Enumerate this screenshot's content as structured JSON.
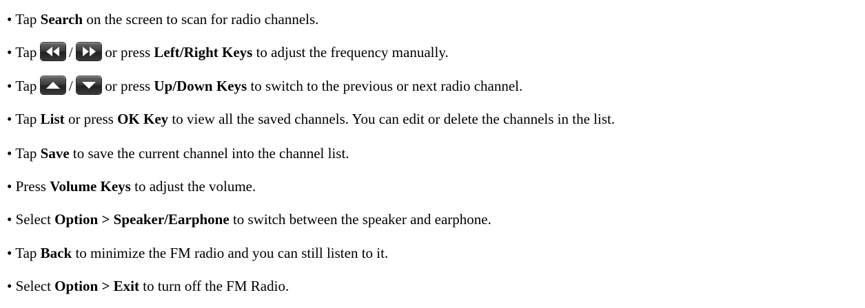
{
  "bullet": "•",
  "lines": [
    {
      "pre": "Tap ",
      "b1": "Search",
      "post": " on the screen to scan for radio channels."
    },
    {
      "pre": "Tap ",
      "sep": " / ",
      "mid": " or press ",
      "b1": "Left/Right Keys",
      "post": " to adjust the frequency manually."
    },
    {
      "pre": "Tap ",
      "sep": " / ",
      "mid": " or press ",
      "b1": "Up/Down Keys",
      "post": " to switch to the previous or next radio channel."
    },
    {
      "pre": "Tap ",
      "b1": "List",
      "mid": " or press ",
      "b2": "OK Key",
      "post": " to view all the saved channels. You can edit or delete the channels in the list."
    },
    {
      "pre": "Tap ",
      "b1": "Save",
      "post": " to save the current channel into the channel list."
    },
    {
      "pre": "Press ",
      "b1": "Volume Keys",
      "post": " to adjust the volume."
    },
    {
      "pre": "Select ",
      "b1": "Option > Speaker/Earphone",
      "post": " to switch between the speaker and earphone."
    },
    {
      "pre": "Tap ",
      "b1": "Back",
      "post": " to minimize the FM radio and you can still listen to it."
    },
    {
      "pre": "Select ",
      "b1": "Option > Exit",
      "post": " to turn off the FM Radio."
    }
  ],
  "icons": {
    "rewind": "rewind-icon",
    "fast_forward": "fast-forward-icon",
    "up": "up-arrow-icon",
    "down": "down-arrow-icon",
    "glyph_color": "#ffffff"
  }
}
